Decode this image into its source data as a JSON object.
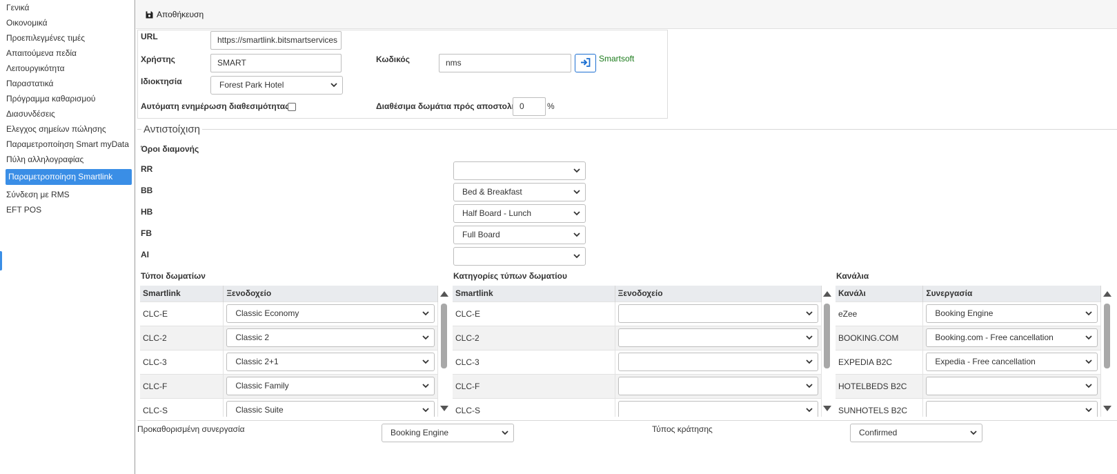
{
  "sidebar": {
    "items": [
      "Γενικά",
      "Οικονομικά",
      "Προεπιλεγμένες τιμές",
      "Απαιτούμενα πεδία",
      "Λειτουργικότητα",
      "Παραστατικά",
      "Πρόγραμμα καθαρισμού",
      "Διασυνδέσεις",
      "Ελεγχος σημείων πώλησης",
      "Παραμετροποίηση Smart myData",
      "Πύλη αλληλογραφίας",
      "Παραμετροποίηση Smartlink",
      "Σύνδεση με RMS",
      "EFT POS"
    ],
    "active_index": 11,
    "accent_color": "#3a8ee6"
  },
  "toolbar": {
    "save_label": "Αποθήκευση",
    "save_icon": "floppy-disk-icon"
  },
  "connection": {
    "url_label": "URL",
    "url_value": "https://smartlink.bitsmartservices",
    "user_label": "Χρήστης",
    "user_value": "SMART",
    "password_label": "Κωδικός",
    "password_value": "nms",
    "login_icon": "sign-in-icon",
    "status_text": "Smartsoft",
    "status_color": "#1a7a1a",
    "property_label": "Ιδιοκτησία",
    "property_value": "Forest Park Hotel",
    "auto_update_label": "Αυτόματη ενημέρωση διαθεσιμότητας",
    "auto_update_checked": false,
    "rooms_send_label": "Διαθέσιμα δωμάτια πρός αποστολή",
    "rooms_send_value": "0",
    "rooms_send_unit": "%"
  },
  "mapping": {
    "section_title": "Αντιστοίχιση",
    "board_terms_title": "Όροι διαμονής",
    "board_terms": [
      {
        "code": "RR",
        "value": ""
      },
      {
        "code": "BB",
        "value": "Bed & Breakfast"
      },
      {
        "code": "HB",
        "value": "Half Board - Lunch"
      },
      {
        "code": "FB",
        "value": "Full Board"
      },
      {
        "code": "AI",
        "value": ""
      }
    ],
    "room_types": {
      "title": "Τύποι δωματίων",
      "columns": [
        "Smartlink",
        "Ξενοδοχείο"
      ],
      "rows": [
        {
          "code": "CLC-E",
          "value": "Classic Economy"
        },
        {
          "code": "CLC-2",
          "value": "Classic 2"
        },
        {
          "code": "CLC-3",
          "value": "Classic 2+1"
        },
        {
          "code": "CLC-F",
          "value": "Classic Family"
        },
        {
          "code": "CLC-S",
          "value": "Classic Suite"
        }
      ]
    },
    "room_categories": {
      "title": "Κατηγορίες τύπων δωματίου",
      "columns": [
        "Smartlink",
        "Ξενοδοχείο"
      ],
      "rows": [
        {
          "code": "CLC-E",
          "value": ""
        },
        {
          "code": "CLC-2",
          "value": ""
        },
        {
          "code": "CLC-3",
          "value": ""
        },
        {
          "code": "CLC-F",
          "value": ""
        },
        {
          "code": "CLC-S",
          "value": ""
        }
      ]
    },
    "channels": {
      "title": "Κανάλια",
      "columns": [
        "Κανάλι",
        "Συνεργασία"
      ],
      "rows": [
        {
          "code": "eZee",
          "value": "Booking Engine"
        },
        {
          "code": "BOOKING.COM",
          "value": "Booking.com - Free cancellation"
        },
        {
          "code": "EXPEDIA B2C",
          "value": "Expedia - Free cancellation"
        },
        {
          "code": "HOTELBEDS B2C",
          "value": ""
        },
        {
          "code": "SUNHOTELS B2C",
          "value": ""
        }
      ]
    }
  },
  "footer": {
    "default_partner_label": "Προκαθορισμένη συνεργασία",
    "default_partner_value": "Booking Engine",
    "booking_type_label": "Τύπος κράτησης",
    "booking_type_value": "Confirmed"
  }
}
